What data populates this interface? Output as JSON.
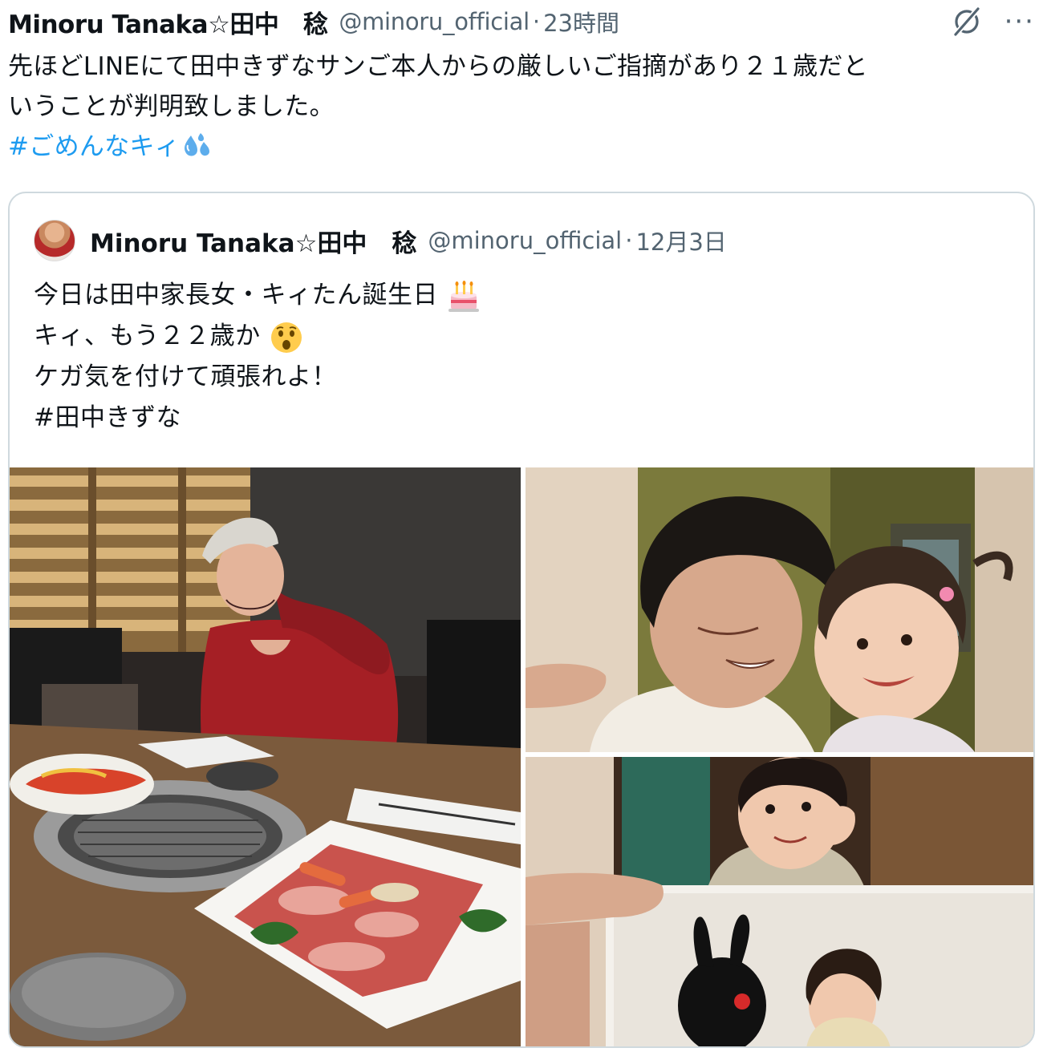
{
  "tweet": {
    "author_name": "Minoru Tanaka☆田中　稔",
    "handle": "@minoru_official",
    "separator": "·",
    "time": "23時間",
    "more_label": "···",
    "text_line1": "先ほどLINEにて田中きずなサンご本人からの厳しいご指摘があり２１歳だと",
    "text_line2": "いうことが判明致しました。",
    "hashtag": "#ごめんなキィ",
    "hashtag_emoji": "sweat-droplets-icon"
  },
  "quoted": {
    "author_name": "Minoru Tanaka☆田中　稔",
    "handle": "@minoru_official",
    "separator": "·",
    "date": "12月3日",
    "line1": "今日は田中家長女・キィたん誕生日",
    "line2": "キィ、もう２２歳か",
    "line3": "ケガ気を付けて頑張れよ！",
    "line4": "#田中きずな",
    "line1_emoji": "birthday-cake-icon",
    "line2_emoji": "hushed-face-icon"
  },
  "colors": {
    "text": "#0f1419",
    "secondary": "#536471",
    "link": "#1d9bf0",
    "border": "#cfd9de"
  }
}
